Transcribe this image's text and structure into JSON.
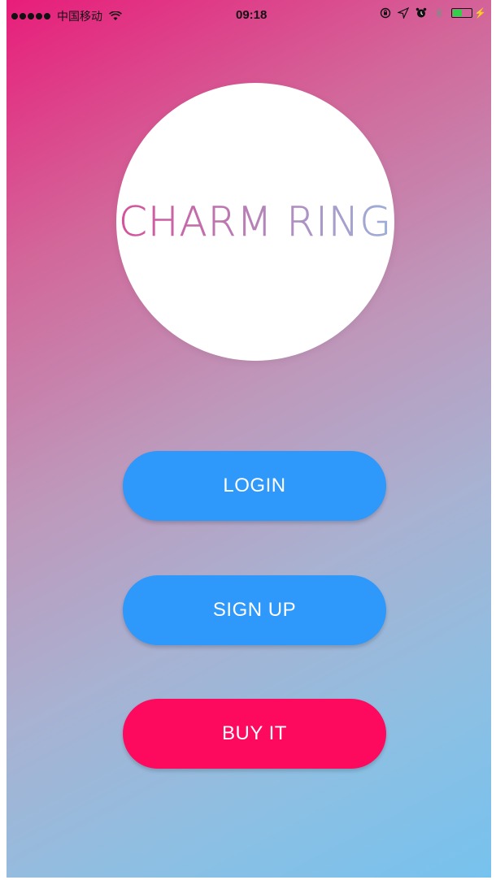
{
  "status_bar": {
    "carrier": "中国移动",
    "time": "09:18",
    "icons": [
      "signal-dots-icon",
      "wifi-icon",
      "rotation-lock-icon",
      "location-icon",
      "alarm-icon",
      "bluetooth-icon",
      "battery-icon",
      "charging-icon"
    ]
  },
  "logo": {
    "text": "CHARM RING"
  },
  "buttons": {
    "login": "LOGIN",
    "signup": "SIGN UP",
    "buy": "BUY IT"
  },
  "colors": {
    "primary_button": "#2f98fb",
    "buy_button": "#fd0a5f",
    "gradient_start": "#e81d7a",
    "gradient_end": "#76c2ee"
  }
}
